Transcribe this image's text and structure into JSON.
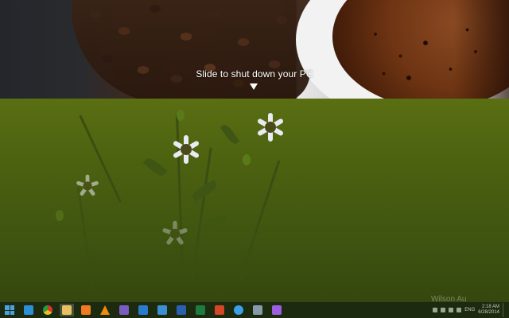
{
  "lock_panel": {
    "slide_text": "Slide to shut down your PC",
    "arrow_icon": "down-arrow-icon"
  },
  "watermark": "Wilson Au",
  "taskbar": {
    "items": [
      {
        "name": "start-button",
        "icon": "windows-logo-icon",
        "color": "#4aa3df"
      },
      {
        "name": "internet-explorer",
        "icon": "internet-explorer-icon",
        "color": "#2d8fd6"
      },
      {
        "name": "chrome",
        "icon": "chrome-icon",
        "color": "#e0a020"
      },
      {
        "name": "file-explorer",
        "icon": "folder-icon",
        "color": "#e8c060",
        "active": true
      },
      {
        "name": "media-player",
        "icon": "media-player-icon",
        "color": "#f07a20"
      },
      {
        "name": "vlc",
        "icon": "traffic-cone-icon",
        "color": "#f08a10"
      },
      {
        "name": "visual-studio-dark",
        "icon": "visual-studio-icon",
        "color": "#7a5cc0"
      },
      {
        "name": "notepad",
        "icon": "notepad-icon",
        "color": "#2a7ad0"
      },
      {
        "name": "remote-desktop",
        "icon": "remote-desktop-icon",
        "color": "#3c90d0"
      },
      {
        "name": "word",
        "icon": "word-icon",
        "color": "#2b5fb0"
      },
      {
        "name": "excel",
        "icon": "excel-icon",
        "color": "#1f7a40"
      },
      {
        "name": "powerpoint",
        "icon": "powerpoint-icon",
        "color": "#d24726"
      },
      {
        "name": "twitter",
        "icon": "twitter-bird-icon",
        "color": "#3aa0e8"
      },
      {
        "name": "network-app",
        "icon": "network-icon",
        "color": "#8899aa"
      },
      {
        "name": "visual-studio",
        "icon": "visual-studio-icon",
        "color": "#9a5fe0"
      }
    ],
    "tray": {
      "language": "ENG",
      "time": "2:18 AM",
      "date": "6/28/2014"
    }
  }
}
